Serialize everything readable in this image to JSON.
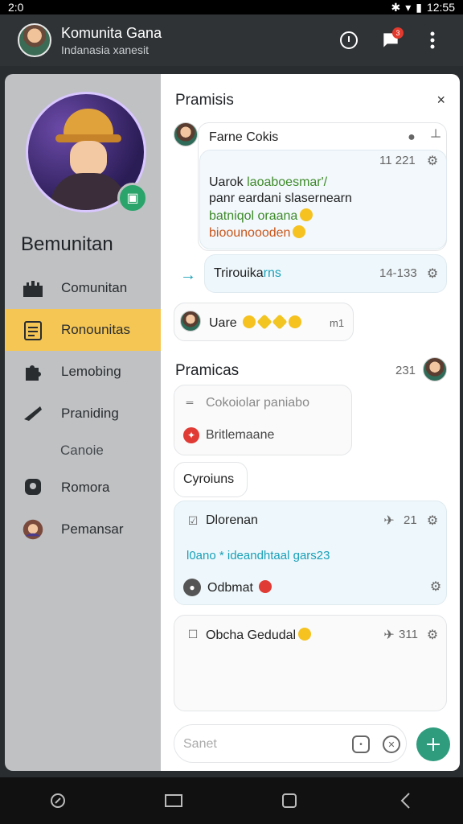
{
  "status": {
    "time": "2:0",
    "right_time": "12:55"
  },
  "appbar": {
    "title": "Komunita Gana",
    "subtitle": "Indanasia xanesit",
    "info_icon": "info-icon",
    "chat_icon": "chat-bubble-icon",
    "badge": "3",
    "menu_icon": "more-vert-icon"
  },
  "sidebar": {
    "heading": "Bemunitan",
    "items": [
      {
        "label": "Comunitan",
        "icon": "castle-icon"
      },
      {
        "label": "Ronounitas",
        "icon": "clipboard-icon",
        "active": true
      },
      {
        "label": "Lemobing",
        "icon": "puzzle-icon"
      },
      {
        "label": "Praniding",
        "icon": "megaphone-icon"
      }
    ],
    "sub_label": "Canoie",
    "items2": [
      {
        "label": "Romora",
        "icon": "location-icon"
      },
      {
        "label": "Pemansar",
        "icon": "avatar-icon"
      }
    ]
  },
  "panel": {
    "title": "Pramisis",
    "close": "×",
    "msg1": {
      "name": "Farne Cokis",
      "time": "11 221",
      "line1a": "Uarok ",
      "line1b": "laoaboesmar'/",
      "line2": "panr eardani slasernearn",
      "line3": "batniqol oraana",
      "line4": "bioounoooden"
    },
    "msg2": {
      "text": "Trirouika",
      "text_teal": "rns",
      "time": "14-133"
    },
    "msg3": {
      "text": "Uare",
      "meta": "m1"
    },
    "section2": {
      "title": "Pramicas",
      "count": "231"
    },
    "card1": {
      "line1": "Cokoiolar paniabo",
      "line2": "Britlemaane"
    },
    "chip": "Cyroiuns",
    "card2": {
      "title": "Dlorenan",
      "meta": "21",
      "teal_line": "l0ano * ideandhtaal gars23",
      "line": "Odbmat"
    },
    "card3": {
      "title": "Obcha Gedudal",
      "meta": "311"
    },
    "input_placeholder": "Sanet"
  },
  "colors": {
    "accent": "#f5c653",
    "fab": "#2f9c7e",
    "teal": "#18a0b8"
  }
}
